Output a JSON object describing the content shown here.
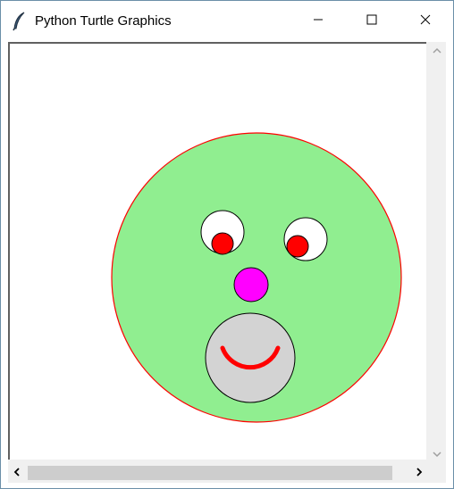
{
  "window": {
    "title": "Python Turtle Graphics",
    "icon": "feather-icon",
    "controls": {
      "minimize": "minimize-icon",
      "maximize": "maximize-icon",
      "close": "close-icon"
    }
  },
  "canvas": {
    "drawing": "face",
    "colors": {
      "face_fill": "#90ee90",
      "face_outline": "#ff0000",
      "eye_white": "#ffffff",
      "pupil": "#ff0000",
      "nose": "#ff00ff",
      "mouth_fill": "#d3d3d3",
      "smile": "#ff0000"
    }
  },
  "scrollbars": {
    "vertical_up": "chevron-up-icon",
    "vertical_down": "chevron-down-icon",
    "horizontal_left": "chevron-left-icon",
    "horizontal_right": "chevron-right-icon"
  }
}
